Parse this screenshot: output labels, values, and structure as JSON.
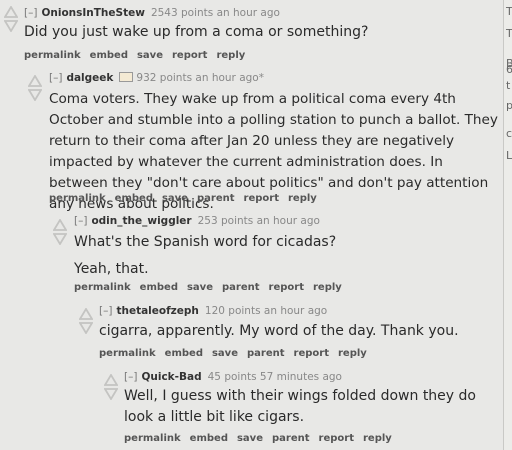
{
  "comments": [
    {
      "author": "OnionsInTheStew",
      "points": "2543 points",
      "ago": "an hour ago",
      "toggle": "[–]",
      "body": [
        "Did you just wake up from a coma or something?"
      ],
      "buttons": [
        "permalink",
        "embed",
        "save",
        "report",
        "reply"
      ]
    },
    {
      "author": "dalgeek",
      "points": "932 points",
      "ago": "an hour ago*",
      "toggle": "[–]",
      "body": [
        "Coma voters. They wake up from a political coma every 4th October and stumble into a polling station to punch a ballot. They return to their coma after Jan 20 unless they are negatively impacted by whatever the current administration does. In between they \"don't care about politics\" and don't pay attention any news about politics."
      ],
      "buttons": [
        "permalink",
        "embed",
        "save",
        "parent",
        "report",
        "reply"
      ]
    },
    {
      "author": "odin_the_wiggler",
      "points": "253 points",
      "ago": "an hour ago",
      "toggle": "[–]",
      "body": [
        "What's the Spanish word for cicadas?",
        "Yeah, that."
      ],
      "buttons": [
        "permalink",
        "embed",
        "save",
        "parent",
        "report",
        "reply"
      ]
    },
    {
      "author": "thetaleofzeph",
      "points": "120 points",
      "ago": "an hour ago",
      "toggle": "[–]",
      "body": [
        "cigarra, apparently. My word of the day. Thank you."
      ],
      "buttons": [
        "permalink",
        "embed",
        "save",
        "parent",
        "report",
        "reply"
      ]
    },
    {
      "author": "Quick-Bad",
      "points": "45 points",
      "ago": "57 minutes ago",
      "toggle": "[–]",
      "body": [
        "Well, I guess with their wings folded down they do look a little bit like cigars."
      ],
      "buttons": [
        "permalink",
        "embed",
        "save",
        "parent",
        "report",
        "reply"
      ]
    }
  ],
  "edge_chars": [
    "T",
    "T",
    "B",
    "6",
    "t",
    "p",
    "c",
    "L"
  ],
  "colors": {
    "background": "#e8e8e6",
    "arrow": "#c6c6c4",
    "author": "#333333",
    "meta": "#888888"
  }
}
